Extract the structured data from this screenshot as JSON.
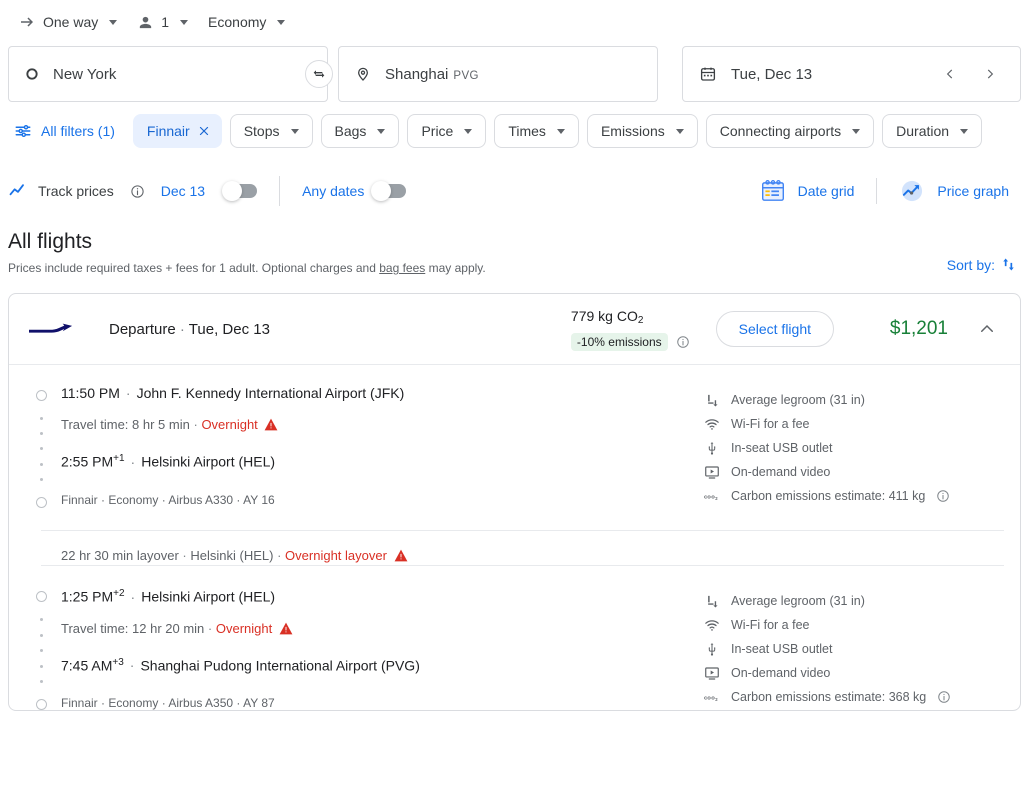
{
  "trip_options": [
    {
      "icon": "arrow-right-icon",
      "label": "One way",
      "has_caret": true
    },
    {
      "icon": "person-icon",
      "label": "1",
      "has_caret": true
    },
    {
      "icon": "",
      "label": "Economy",
      "has_caret": true
    }
  ],
  "search": {
    "origin": {
      "icon": "circle-icon",
      "value": "New York"
    },
    "swap_icon": "swap-horizontal-icon",
    "destination": {
      "icon": "location-pin-icon",
      "value": "Shanghai",
      "code": "PVG"
    },
    "date": {
      "icon": "calendar-icon",
      "value": "Tue, Dec 13"
    },
    "prev_label": "‹",
    "next_label": "›"
  },
  "filters": {
    "all_filters_label": "All filters (1)",
    "chips": [
      {
        "label": "Finnair",
        "active": true,
        "removable": true
      },
      {
        "label": "Stops",
        "active": false,
        "removable": false
      },
      {
        "label": "Bags",
        "active": false,
        "removable": false
      },
      {
        "label": "Price",
        "active": false,
        "removable": false
      },
      {
        "label": "Times",
        "active": false,
        "removable": false
      },
      {
        "label": "Emissions",
        "active": false,
        "removable": false
      },
      {
        "label": "Connecting airports",
        "active": false,
        "removable": false
      },
      {
        "label": "Duration",
        "active": false,
        "removable": false
      }
    ]
  },
  "track": {
    "label": "Track prices",
    "date_label": "Dec 13",
    "date_toggle_on": false,
    "any_dates_label": "Any dates",
    "any_dates_toggle_on": false,
    "date_grid_label": "Date grid",
    "price_graph_label": "Price graph"
  },
  "results": {
    "title": "All flights",
    "note_prefix": "Prices include required taxes + fees for 1 adult. Optional charges and ",
    "note_link": "bag fees",
    "note_suffix": " may apply.",
    "sort_label": "Sort by:"
  },
  "flight": {
    "airline_logo": "finnair-logo",
    "header_title": "Departure",
    "header_sep": "·",
    "header_date": "Tue, Dec 13",
    "co2_value": "779 kg CO",
    "co2_sub": "2",
    "co2_badge": "-10% emissions",
    "select_label": "Select flight",
    "price": "$1,201",
    "expanded": true,
    "legs": [
      {
        "depart_time": "11:50 PM",
        "depart_suffix": "",
        "depart_sep": "·",
        "depart_airport": "John F. Kennedy International Airport (JFK)",
        "travel_time": "Travel time: 8 hr 5 min",
        "travel_sep": "·",
        "overnight": "Overnight",
        "arrive_time": "2:55 PM",
        "arrive_suffix": "+1",
        "arrive_sep": "·",
        "arrive_airport": "Helsinki Airport (HEL)",
        "meta": "Finnair · Economy · Airbus A330 · AY 16",
        "amenities": [
          {
            "icon": "legroom-icon",
            "label": "Average legroom (31 in)",
            "info": false
          },
          {
            "icon": "wifi-icon",
            "label": "Wi-Fi for a fee",
            "info": false
          },
          {
            "icon": "usb-icon",
            "label": "In-seat USB outlet",
            "info": false
          },
          {
            "icon": "video-icon",
            "label": "On-demand video",
            "info": false
          },
          {
            "icon": "co2-icon",
            "label": "Carbon emissions estimate: 411 kg",
            "info": true
          }
        ]
      },
      {
        "depart_time": "1:25 PM",
        "depart_suffix": "+2",
        "depart_sep": "·",
        "depart_airport": "Helsinki Airport (HEL)",
        "travel_time": "Travel time: 12 hr 20 min",
        "travel_sep": "·",
        "overnight": "Overnight",
        "arrive_time": "7:45 AM",
        "arrive_suffix": "+3",
        "arrive_sep": "·",
        "arrive_airport": "Shanghai Pudong International Airport (PVG)",
        "meta": "Finnair · Economy · Airbus A350 · AY 87",
        "amenities": [
          {
            "icon": "legroom-icon",
            "label": "Average legroom (31 in)",
            "info": false
          },
          {
            "icon": "wifi-icon",
            "label": "Wi-Fi for a fee",
            "info": false
          },
          {
            "icon": "usb-icon",
            "label": "In-seat USB outlet",
            "info": false
          },
          {
            "icon": "video-icon",
            "label": "On-demand video",
            "info": false
          },
          {
            "icon": "co2-icon",
            "label": "Carbon emissions estimate: 368 kg",
            "info": true
          }
        ]
      }
    ],
    "layover": {
      "duration": "22 hr 30 min layover",
      "sep1": "·",
      "airport": "Helsinki (HEL)",
      "sep2": "·",
      "warning": "Overnight layover"
    }
  },
  "colors": {
    "accent_blue": "#1a73e8",
    "price_green": "#188038",
    "warning_red": "#d93025",
    "chip_active_bg": "#e8f0fe",
    "badge_green_bg": "#e6f4ea",
    "finnair_navy": "#10106a"
  }
}
